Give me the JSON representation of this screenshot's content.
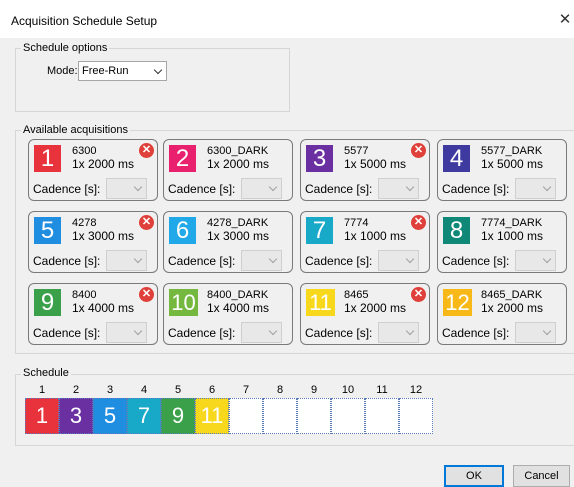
{
  "window": {
    "title": "Acquisition Schedule Setup",
    "close_glyph": "✕"
  },
  "schedule_options": {
    "label": "Schedule options",
    "mode_label": "Mode:",
    "mode_value": "Free-Run"
  },
  "available": {
    "label": "Available acquisitions",
    "cadence_label": "Cadence [s]:",
    "remove_glyph": "✕",
    "items": [
      {
        "num": "1",
        "name": "6300",
        "exposure": "1x 2000 ms",
        "color": "#e8323c",
        "removable": true
      },
      {
        "num": "2",
        "name": "6300_DARK",
        "exposure": "1x 2000 ms",
        "color": "#e8206e",
        "removable": false
      },
      {
        "num": "3",
        "name": "5577",
        "exposure": "1x 5000 ms",
        "color": "#6a2fa0",
        "removable": true
      },
      {
        "num": "4",
        "name": "5577_DARK",
        "exposure": "1x 5000 ms",
        "color": "#3e3aa0",
        "removable": false
      },
      {
        "num": "5",
        "name": "4278",
        "exposure": "1x 3000 ms",
        "color": "#1f8de0",
        "removable": true
      },
      {
        "num": "6",
        "name": "4278_DARK",
        "exposure": "1x 3000 ms",
        "color": "#20a8e8",
        "removable": false
      },
      {
        "num": "7",
        "name": "7774",
        "exposure": "1x 1000 ms",
        "color": "#18a8c8",
        "removable": true
      },
      {
        "num": "8",
        "name": "7774_DARK",
        "exposure": "1x 1000 ms",
        "color": "#108878",
        "removable": false
      },
      {
        "num": "9",
        "name": "8400",
        "exposure": "1x 4000 ms",
        "color": "#3aa04a",
        "removable": true
      },
      {
        "num": "10",
        "name": "8400_DARK",
        "exposure": "1x 4000 ms",
        "color": "#74b840",
        "removable": false
      },
      {
        "num": "11",
        "name": "8465",
        "exposure": "1x 2000 ms",
        "color": "#f8d81c",
        "removable": true
      },
      {
        "num": "12",
        "name": "8465_DARK",
        "exposure": "1x 2000 ms",
        "color": "#f8b818",
        "removable": false
      }
    ]
  },
  "schedule": {
    "label": "Schedule",
    "slot_numbers": [
      "1",
      "2",
      "3",
      "4",
      "5",
      "6",
      "7",
      "8",
      "9",
      "10",
      "11",
      "12"
    ],
    "slots": [
      {
        "value": "1",
        "color": "#e8323c"
      },
      {
        "value": "3",
        "color": "#6a2fa0"
      },
      {
        "value": "5",
        "color": "#1f8de0"
      },
      {
        "value": "7",
        "color": "#18a8c8"
      },
      {
        "value": "9",
        "color": "#3aa04a"
      },
      {
        "value": "11",
        "color": "#f8d81c"
      },
      {
        "value": "",
        "color": "#ffffff"
      },
      {
        "value": "",
        "color": "#ffffff"
      },
      {
        "value": "",
        "color": "#ffffff"
      },
      {
        "value": "",
        "color": "#ffffff"
      },
      {
        "value": "",
        "color": "#ffffff"
      },
      {
        "value": "",
        "color": "#ffffff"
      }
    ]
  },
  "buttons": {
    "ok": "OK",
    "cancel": "Cancel"
  }
}
